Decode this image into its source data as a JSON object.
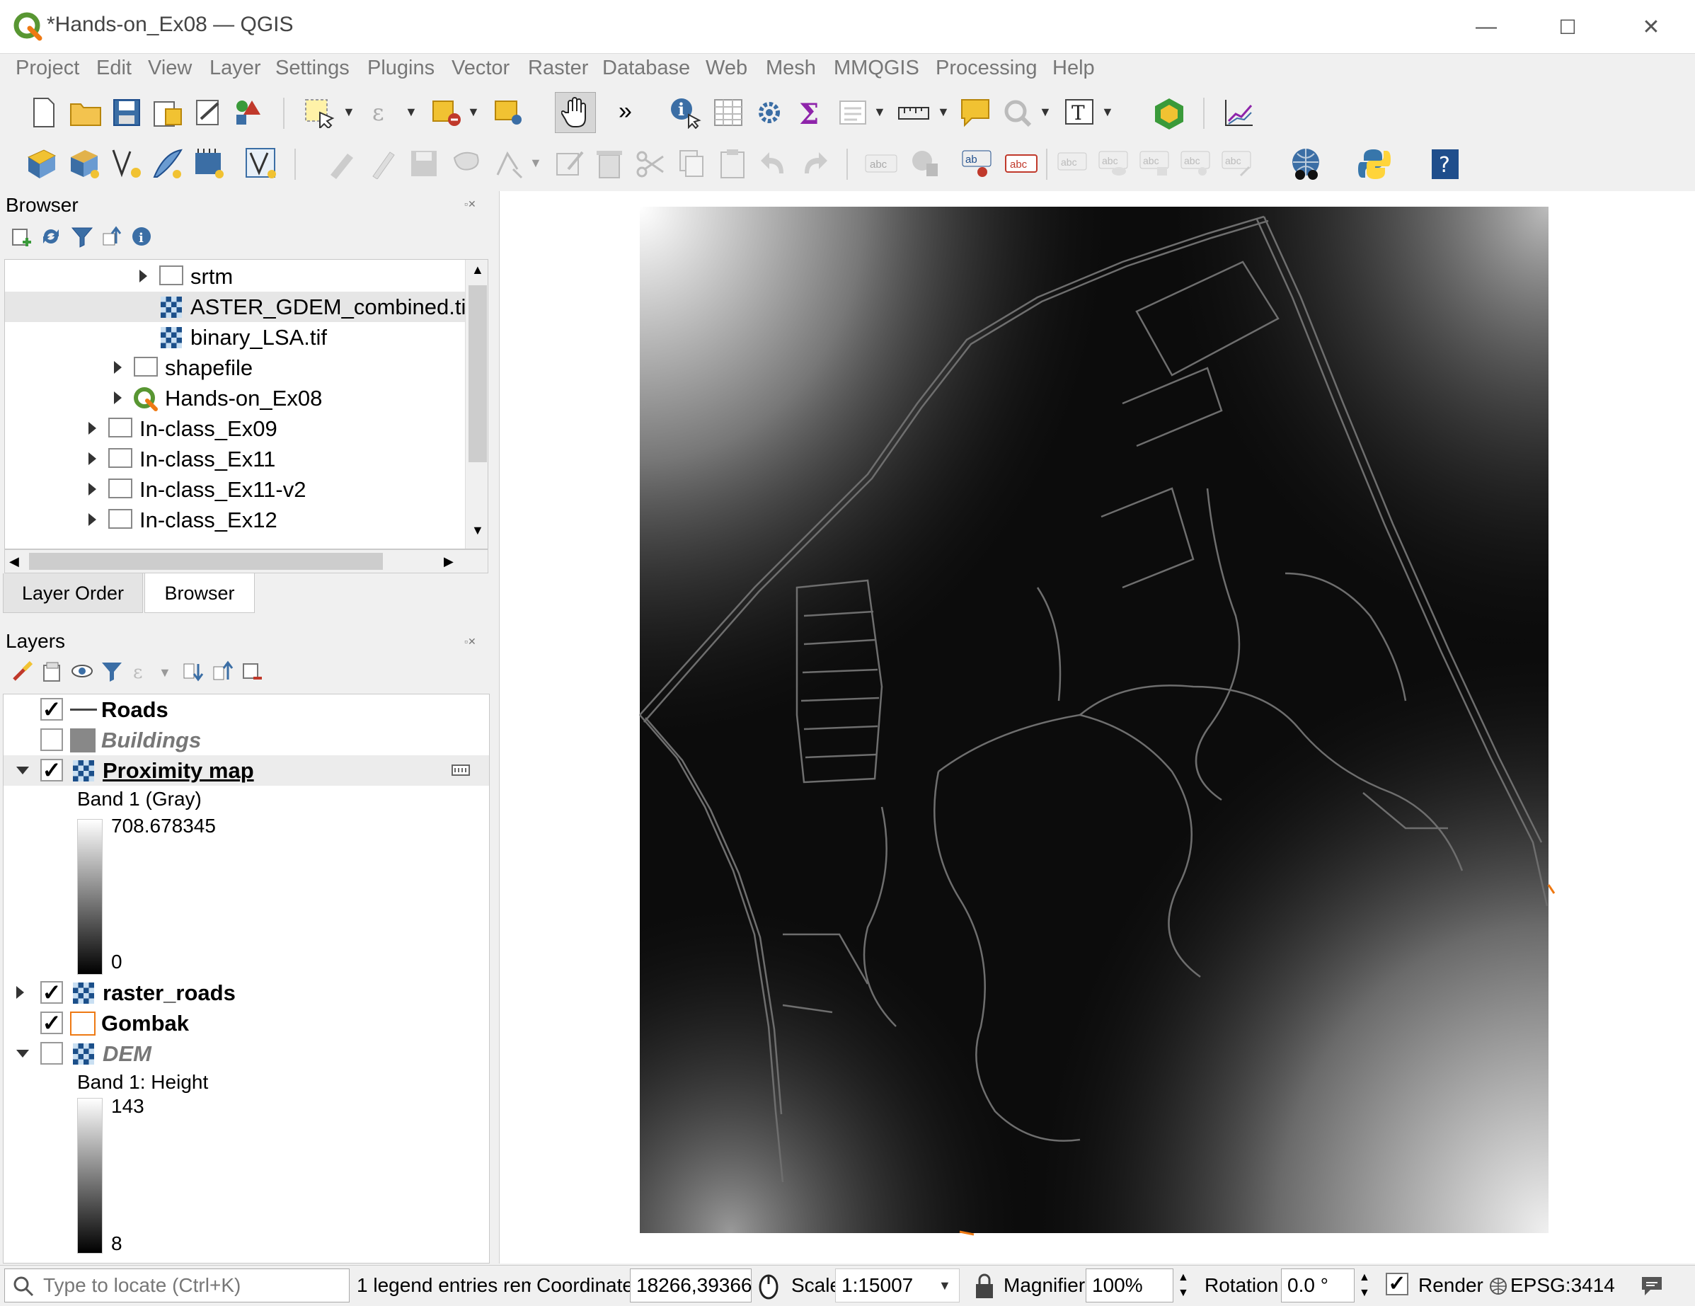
{
  "window": {
    "title": "*Hands-on_Ex08 — QGIS",
    "min": "—",
    "max": "☐",
    "close": "✕"
  },
  "menu": [
    "Project",
    "Edit",
    "View",
    "Layer",
    "Settings",
    "Plugins",
    "Vector",
    "Raster",
    "Database",
    "Web",
    "Mesh",
    "MMQGIS",
    "Processing",
    "Help"
  ],
  "toolbar": {
    "more": "»"
  },
  "browser": {
    "title": "Browser",
    "items": [
      "srtm",
      "ASTER_GDEM_combined.tif",
      "binary_LSA.tif",
      "shapefile",
      "Hands-on_Ex08",
      "In-class_Ex09",
      "In-class_Ex11",
      "In-class_Ex11-v2",
      "In-class_Ex12"
    ]
  },
  "tabs": {
    "layer_order": "Layer Order",
    "browser": "Browser"
  },
  "layers": {
    "title": "Layers",
    "items": [
      "Roads",
      "Buildings",
      "Proximity map",
      "raster_roads",
      "Gombak",
      "DEM"
    ],
    "checked": [
      true,
      false,
      true,
      true,
      true,
      false
    ],
    "proximity": {
      "band": "Band 1 (Gray)",
      "max": "708.678345",
      "min": "0"
    },
    "dem": {
      "band": "Band 1: Height",
      "max": "143",
      "min": "8"
    }
  },
  "status": {
    "locate_placeholder": "Type to locate (Ctrl+K)",
    "message": "1 legend entries rem",
    "coordinate_label": "Coordinate",
    "coordinate": "18266,39366",
    "scale_label": "Scale",
    "scale": "1:15007",
    "magnifier_label": "Magnifier",
    "magnifier": "100%",
    "rotation_label": "Rotation",
    "rotation": "0.0 °",
    "render_label": "Render",
    "crs": "EPSG:3414"
  },
  "colors": {
    "accent": "#3a9a3a",
    "brand_yellow": "#f1c232",
    "link_blue": "#1f4e8c"
  }
}
